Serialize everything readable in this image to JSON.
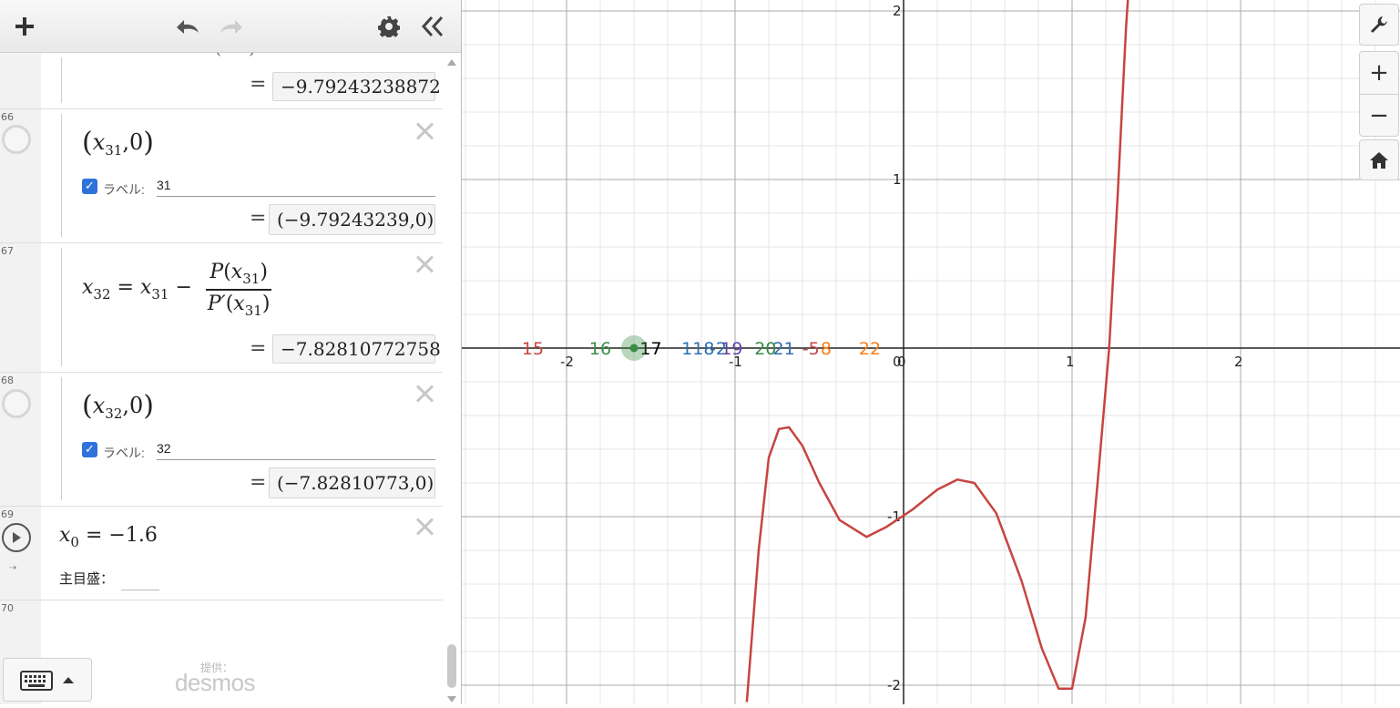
{
  "toolbar": {
    "add_icon": "plus-icon",
    "undo_icon": "undo-icon",
    "redo_icon": "redo-icon",
    "settings_icon": "gear-icon",
    "collapse_icon": "double-chevron-left-icon"
  },
  "expressions": [
    {
      "partial_top": "(−∞)",
      "result": "−9.79243238872"
    },
    {
      "number": "66",
      "x_var": "x",
      "x_sub": "31",
      "y_val": "0",
      "label_caption": "ラベル:",
      "label_value": "31",
      "result": "(−9.79243239,0)"
    },
    {
      "number": "67",
      "lhs_var": "x",
      "lhs_sub": "32",
      "rhs_var": "x",
      "rhs_sub": "31",
      "num_fn": "P",
      "den_fn": "P′",
      "arg_var": "x",
      "arg_sub": "31",
      "result": "−7.82810772758"
    },
    {
      "number": "68",
      "x_var": "x",
      "x_sub": "32",
      "y_val": "0",
      "label_caption": "ラベル:",
      "label_value": "32",
      "result": "(−7.82810773,0)"
    },
    {
      "number": "69",
      "var": "x",
      "sub": "0",
      "value": "−1.6",
      "slider_label": "主目盛："
    },
    {
      "number": "70"
    }
  ],
  "brand": {
    "small": "提供：",
    "name": "desmos"
  },
  "graph_controls": {
    "wrench_icon": "wrench-icon",
    "zoom_in": "+",
    "zoom_out": "−",
    "home_icon": "home-icon"
  },
  "axes": {
    "x_ticks": [
      "-2",
      "-1",
      "0",
      "1",
      "2"
    ],
    "y_ticks": [
      "2",
      "1",
      "-1",
      "-2"
    ],
    "xlim": [
      -2.65,
      2.9
    ],
    "ylim": [
      -2.1,
      2.05
    ]
  },
  "point_labels": [
    {
      "text": "15",
      "x": -2.2,
      "color": "#c74440"
    },
    {
      "text": "16",
      "x": -1.8,
      "color": "#388c46"
    },
    {
      "text": "17",
      "x": -1.5,
      "color": "#000000"
    },
    {
      "text": "118",
      "x": -1.22,
      "color": "#2d70b3"
    },
    {
      "text": "-2",
      "x": -1.1,
      "color": "#2d70b3"
    },
    {
      "text": "19",
      "x": -1.02,
      "color": "#6042a6"
    },
    {
      "text": "20",
      "x": -0.82,
      "color": "#388c46"
    },
    {
      "text": "21",
      "x": -0.71,
      "color": "#2d70b3"
    },
    {
      "text": "-5",
      "x": -0.55,
      "color": "#c74440"
    },
    {
      "text": "8",
      "x": -0.46,
      "color": "#fa7e19"
    },
    {
      "text": "22",
      "x": -0.2,
      "color": "#fa7e19"
    }
  ],
  "highlighted_point": {
    "x": -1.6,
    "y": 0,
    "color": "#388c46"
  },
  "curve_color": "#c74440"
}
